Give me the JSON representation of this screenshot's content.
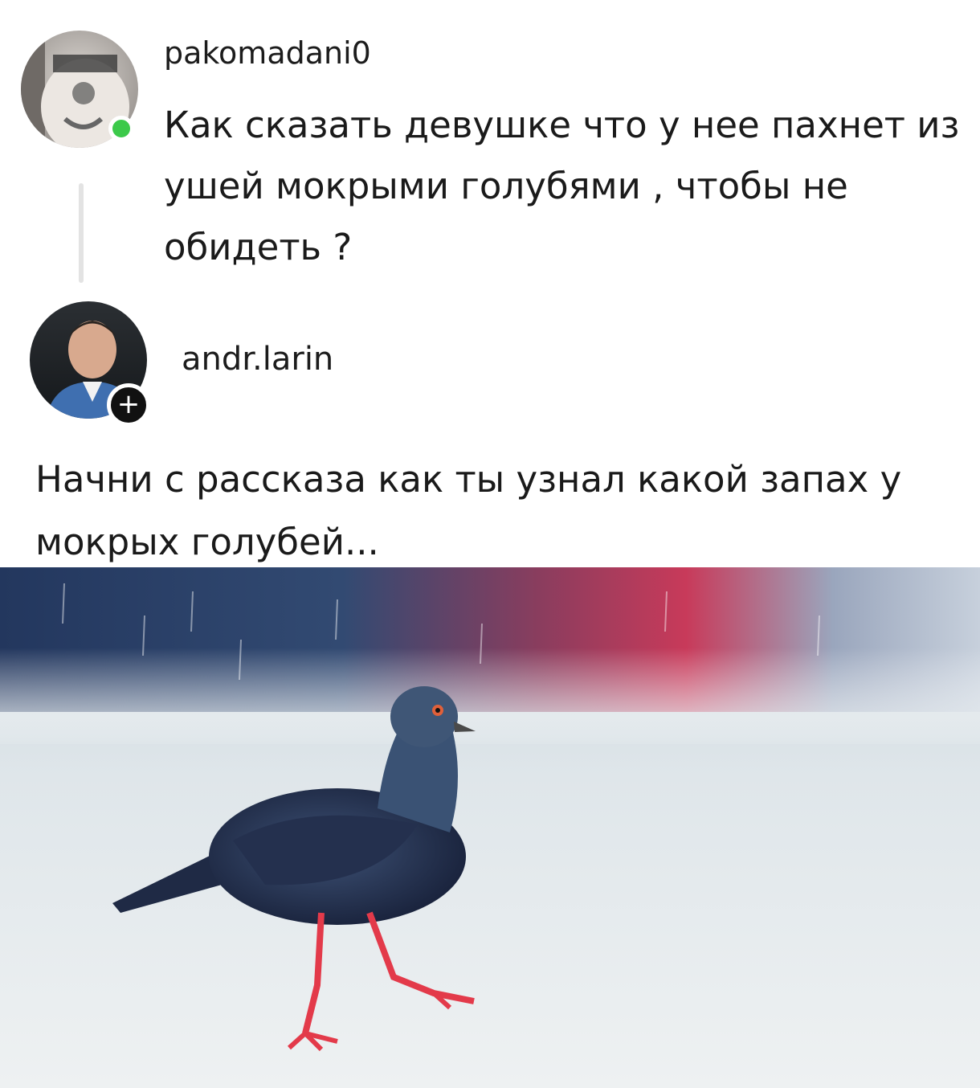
{
  "original_comment": {
    "username": "pakomadani0",
    "text": "Как сказать девушке что у нее пахнет из ушей мокрыми голубями , чтобы не обидеть ?",
    "avatar_icon": "avatar-photo-hoodie",
    "online_status_color": "#3cc94a"
  },
  "reply": {
    "username": "andr.larin",
    "text": "Начни с рассказа как ты узнал какой запах у мокрых голубей...",
    "avatar_icon": "avatar-photo-man",
    "follow_badge_icon": "plus-icon",
    "follow_badge_glyph": "+"
  },
  "attached_image": {
    "subject": "pigeon-photo"
  }
}
